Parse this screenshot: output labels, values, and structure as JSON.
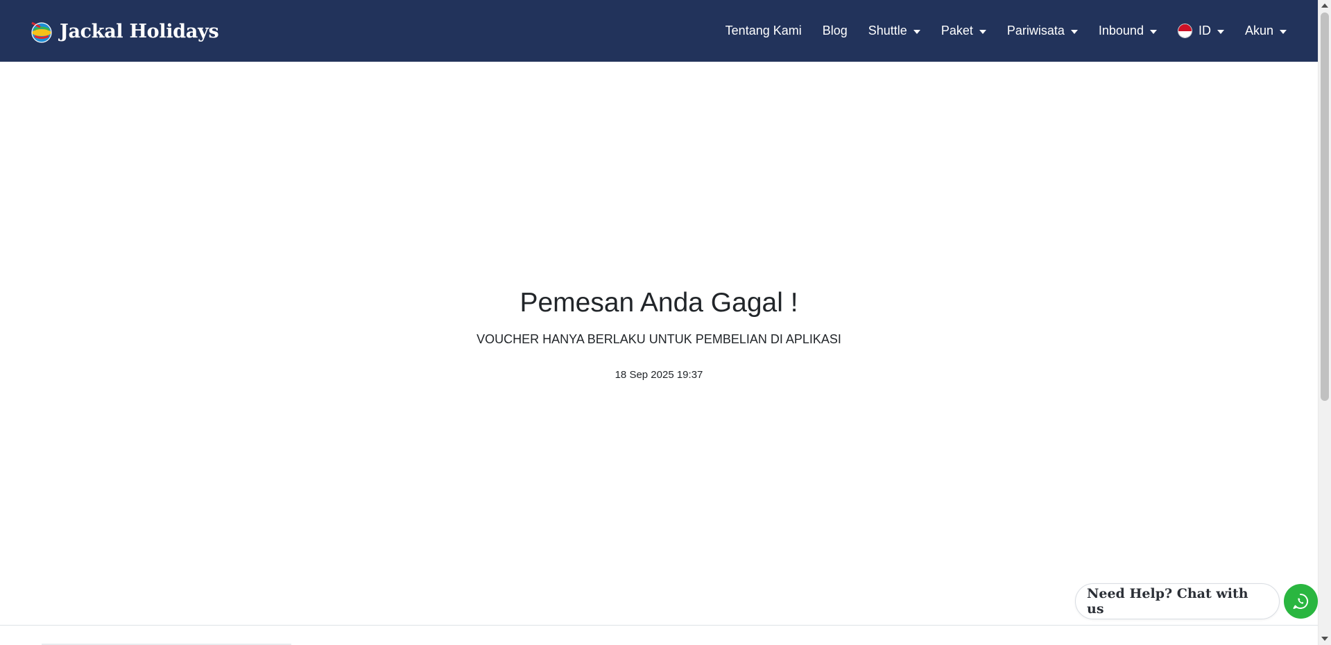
{
  "brand": {
    "name": "Jackal Holidays",
    "logo_icon": "globe-logo-icon"
  },
  "nav": {
    "items": [
      {
        "label": "Tentang Kami",
        "dropdown": false
      },
      {
        "label": "Blog",
        "dropdown": false
      },
      {
        "label": "Shuttle",
        "dropdown": true
      },
      {
        "label": "Paket",
        "dropdown": true
      },
      {
        "label": "Pariwisata",
        "dropdown": true
      },
      {
        "label": "Inbound",
        "dropdown": true
      }
    ],
    "language": {
      "label": "ID",
      "flag_icon": "indonesia-flag-icon"
    },
    "account": {
      "label": "Akun"
    }
  },
  "result": {
    "title": "Pemesan Anda Gagal !",
    "message": "VOUCHER HANYA BERLAKU UNTUK PEMBELIAN DI APLIKASI",
    "timestamp": "18 Sep 2025 19:37"
  },
  "help": {
    "label": "Need Help? Chat with us",
    "icon": "whatsapp-icon"
  },
  "colors": {
    "navbar": "#22335b",
    "nav_text": "#ffffff",
    "whatsapp": "#2ab640",
    "flag_red": "#ce1126",
    "flag_white": "#ffffff"
  }
}
